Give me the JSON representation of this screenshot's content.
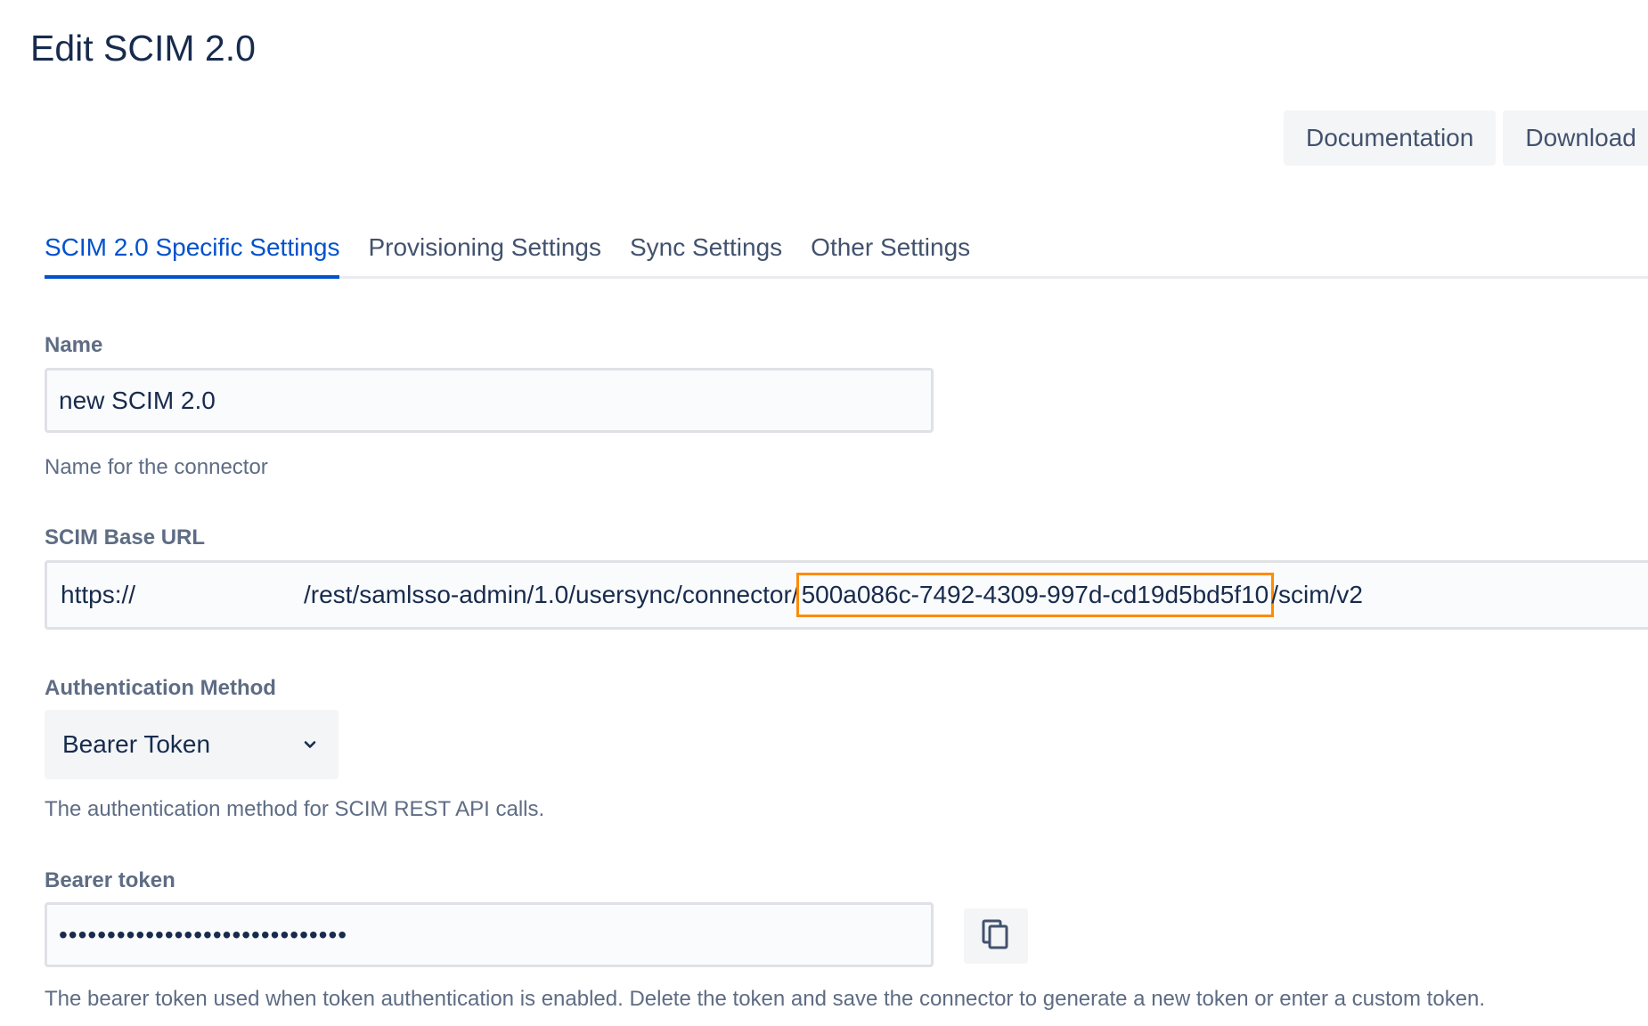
{
  "page": {
    "title": "Edit SCIM 2.0"
  },
  "toolbar": {
    "documentation_label": "Documentation",
    "download_label": "Download"
  },
  "tabs": [
    {
      "label": "SCIM 2.0 Specific Settings",
      "active": true
    },
    {
      "label": "Provisioning Settings",
      "active": false
    },
    {
      "label": "Sync Settings",
      "active": false
    },
    {
      "label": "Other Settings",
      "active": false
    }
  ],
  "name_field": {
    "label": "Name",
    "value": "new SCIM 2.0",
    "help": "Name for the connector"
  },
  "scim_base_url": {
    "label": "SCIM Base URL",
    "prefix": "https://",
    "path": "/rest/samlsso-admin/1.0/usersync/connector/",
    "connector_id": "500a086c-7492-4309-997d-cd19d5bd5f10",
    "suffix": "/scim/v2",
    "highlight_color": "#ff8b00"
  },
  "auth_method": {
    "label": "Authentication Method",
    "selected": "Bearer Token",
    "help": "The authentication method for SCIM REST API calls."
  },
  "bearer_token": {
    "label": "Bearer token",
    "masked_value": "••••••••••••••••••••••••••••••",
    "help": "The bearer token used when token authentication is enabled. Delete the token and save the connector to generate a new token or enter a custom token.",
    "copy_icon": "copy-icon"
  },
  "colors": {
    "primary": "#0052cc",
    "text": "#172b4d",
    "subtle_text": "#5e6c84",
    "highlight": "#ff8b00"
  }
}
